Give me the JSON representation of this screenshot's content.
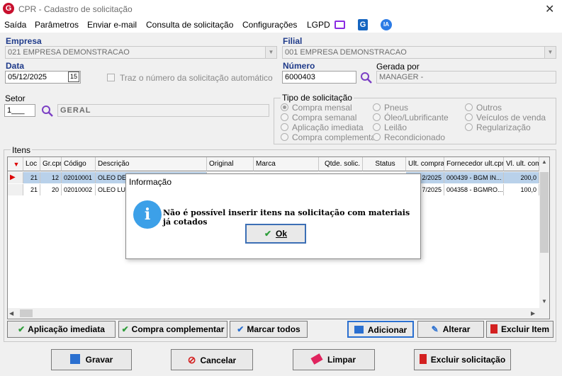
{
  "window": {
    "title": "CPR - Cadastro de solicitação",
    "app_logo": "G"
  },
  "menu": {
    "items": [
      "Saída",
      "Parâmetros",
      "Enviar e-mail",
      "Consulta de solicitação",
      "Configurações",
      "LGPD"
    ],
    "ia_badge": "IA"
  },
  "form": {
    "empresa_label": "Empresa",
    "empresa_value": "021 EMPRESA DEMONSTRACAO",
    "filial_label": "Filial",
    "filial_value": "001 EMPRESA DEMONSTRACAO",
    "data_label": "Data",
    "data_value": "05/12/2025",
    "calendar_icon_text": "15",
    "auto_number_label": "Traz o número da solicitação automático",
    "numero_label": "Número",
    "numero_value": "6000403",
    "gerada_label": "Gerada por",
    "gerada_value": "MANAGER -",
    "setor_label": "Setor",
    "setor_value": "1___",
    "setor_desc": "GERAL"
  },
  "tipo": {
    "title": "Tipo de solicitação",
    "options": [
      "Compra mensal",
      "Compra semanal",
      "Aplicação imediata",
      "Compra complementar",
      "Pneus",
      "Óleo/Lubrificante",
      "Leilão",
      "Recondicionado",
      "Outros",
      "Veículos de venda",
      "Regularização"
    ],
    "selected": "Compra mensal"
  },
  "itens": {
    "title": "Itens",
    "columns": [
      "Loc",
      "Gr.cpr",
      "Código",
      "Descrição",
      "Original",
      "Marca",
      "Qtde. solic.",
      "Status",
      "Ult. compra",
      "Fornecedor ult.cpr",
      "Vl. ult. com"
    ],
    "rows": [
      [
        "21",
        "12",
        "02010001",
        "OLEO DE",
        "",
        "",
        "",
        "",
        "2/2025",
        "000439 - BGM IN...",
        "200,0"
      ],
      [
        "21",
        "20",
        "02010002",
        "OLEO LU",
        "",
        "",
        "",
        "",
        "7/2025",
        "004358 - BGMRO...",
        "100,0"
      ]
    ]
  },
  "buttons": {
    "aplicacao": "Aplicação imediata",
    "complementar": "Compra complementar",
    "marcar": "Marcar todos",
    "adicionar": "Adicionar",
    "alterar": "Alterar",
    "excluir_item": "Excluir Item",
    "gravar": "Gravar",
    "cancelar": "Cancelar",
    "limpar": "Limpar",
    "excluir_solicitacao": "Excluir solicitação"
  },
  "dialog": {
    "title": "Informação",
    "message": "Não é possível inserir itens na solicitação com materiais já cotados",
    "ok": "Ok"
  }
}
